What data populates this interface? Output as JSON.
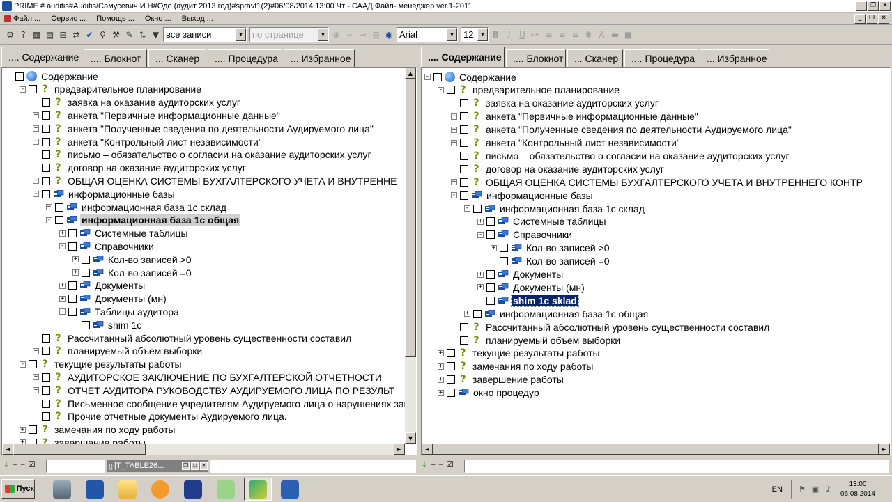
{
  "window": {
    "title": "PRIME # auditis#Auditis/Самусевич И.Н#Одо  (аудит 2013 год)#spravt1(2)#06/08/2014 13:00 Чт - САAД Файл- менеджер ver.1-2011",
    "controls": [
      "_",
      "❐",
      "✕"
    ]
  },
  "menu": {
    "items": [
      "Файл ...",
      "Сервис ...",
      "Помощь ...",
      "Окно ...",
      "Выход ..."
    ]
  },
  "toolbar": {
    "records_filter": "все записи",
    "per_page": "по странице",
    "font_name": "Arial",
    "font_size": "12",
    "format_buttons": [
      "B",
      "I",
      "U",
      "ABC"
    ]
  },
  "left_panel": {
    "tabs": [
      ".... Содержание",
      ".... Блокнот",
      "... Сканер",
      ".... Процедура",
      "... Избранное"
    ],
    "active_tab": 0,
    "tree": [
      {
        "label": "Содержание",
        "level": 0,
        "exp": "",
        "icon": "globe"
      },
      {
        "label": "предварительное планирование",
        "level": 1,
        "exp": "-",
        "icon": "q"
      },
      {
        "label": "заявка на оказание аудиторских услуг",
        "level": 2,
        "exp": "",
        "icon": "q"
      },
      {
        "label": "анкета \"Первичные информационные данные\"",
        "level": 2,
        "exp": "+",
        "icon": "q"
      },
      {
        "label": "анкета \"Полученные сведения по деятельности Аудируемого лица\"",
        "level": 2,
        "exp": "+",
        "icon": "q"
      },
      {
        "label": "анкета \"Контрольный лист независимости\"",
        "level": 2,
        "exp": "+",
        "icon": "q"
      },
      {
        "label": "письмо – обязательство о согласии на оказание аудиторских услуг",
        "level": 2,
        "exp": "",
        "icon": "q"
      },
      {
        "label": "договор на оказание аудиторских услуг",
        "level": 2,
        "exp": "",
        "icon": "q"
      },
      {
        "label": "ОБЩАЯ ОЦЕНКА СИСТЕМЫ БУХГАЛТЕРСКОГО УЧЕТА И ВНУТРЕННЕ",
        "level": 2,
        "exp": "+",
        "icon": "q"
      },
      {
        "label": "информационные базы",
        "level": 2,
        "exp": "-",
        "icon": "db"
      },
      {
        "label": "информационная база  1с склад",
        "level": 3,
        "exp": "+",
        "icon": "db"
      },
      {
        "label": "информационная база 1с общая",
        "level": 3,
        "exp": "-",
        "icon": "db",
        "sel": "grey"
      },
      {
        "label": "Системные таблицы",
        "level": 4,
        "exp": "+",
        "icon": "db"
      },
      {
        "label": "Справочники",
        "level": 4,
        "exp": "-",
        "icon": "db"
      },
      {
        "label": "Кол-во записей >0",
        "level": 5,
        "exp": "+",
        "icon": "db"
      },
      {
        "label": "Кол-во записей =0",
        "level": 5,
        "exp": "+",
        "icon": "db"
      },
      {
        "label": "Документы",
        "level": 4,
        "exp": "+",
        "icon": "db"
      },
      {
        "label": "Документы (мн)",
        "level": 4,
        "exp": "+",
        "icon": "db"
      },
      {
        "label": "Таблицы аудитора",
        "level": 4,
        "exp": "-",
        "icon": "db"
      },
      {
        "label": "shim 1c",
        "level": 5,
        "exp": "",
        "icon": "db"
      },
      {
        "label": "Рассчитанный абсолютный уровень существенности составил",
        "level": 2,
        "exp": "",
        "icon": "q"
      },
      {
        "label": "планируемый объем выборки",
        "level": 2,
        "exp": "+",
        "icon": "q"
      },
      {
        "label": "текущие результаты работы",
        "level": 1,
        "exp": "-",
        "icon": "q"
      },
      {
        "label": "АУДИТОРСКОЕ ЗАКЛЮЧЕНИЕ ПО БУХГАЛТЕРСКОЙ ОТЧЕТНОСТИ",
        "level": 2,
        "exp": "+",
        "icon": "q"
      },
      {
        "label": "ОТЧЕТ АУДИТОРА РУКОВОДСТВУ АУДИРУЕМОГО ЛИЦА ПО РЕЗУЛЬТ",
        "level": 2,
        "exp": "+",
        "icon": "q"
      },
      {
        "label": "Письменное сообщение учредителям Аудируемого лица о нарушениях зак",
        "level": 2,
        "exp": "",
        "icon": "q"
      },
      {
        "label": "Прочие отчетные документы Аудируемого лица.",
        "level": 2,
        "exp": "",
        "icon": "q"
      },
      {
        "label": "замечания по ходу работы",
        "level": 1,
        "exp": "+",
        "icon": "q"
      },
      {
        "label": "завершение работы",
        "level": 1,
        "exp": "+",
        "icon": "q"
      }
    ]
  },
  "right_panel": {
    "tabs": [
      ".... Содержание",
      ".... Блокнот",
      "... Сканер",
      ".... Процедура",
      "... Избранное"
    ],
    "active_tab": 0,
    "tree": [
      {
        "label": "Содержание",
        "level": 0,
        "exp": "-",
        "icon": "globe"
      },
      {
        "label": "предварительное планирование",
        "level": 1,
        "exp": "-",
        "icon": "q"
      },
      {
        "label": "заявка на оказание аудиторских услуг",
        "level": 2,
        "exp": "",
        "icon": "q"
      },
      {
        "label": "анкета \"Первичные информационные данные\"",
        "level": 2,
        "exp": "+",
        "icon": "q"
      },
      {
        "label": "анкета \"Полученные сведения по деятельности Аудируемого лица\"",
        "level": 2,
        "exp": "+",
        "icon": "q"
      },
      {
        "label": "анкета \"Контрольный лист независимости\"",
        "level": 2,
        "exp": "+",
        "icon": "q"
      },
      {
        "label": "письмо – обязательство о согласии на оказание аудиторских услуг",
        "level": 2,
        "exp": "",
        "icon": "q"
      },
      {
        "label": "договор на оказание аудиторских услуг",
        "level": 2,
        "exp": "",
        "icon": "q"
      },
      {
        "label": "ОБЩАЯ ОЦЕНКА СИСТЕМЫ БУХГАЛТЕРСКОГО УЧЕТА И ВНУТРЕННЕГО КОНТР",
        "level": 2,
        "exp": "+",
        "icon": "q"
      },
      {
        "label": "информационные базы",
        "level": 2,
        "exp": "-",
        "icon": "db"
      },
      {
        "label": "информационная база  1с склад",
        "level": 3,
        "exp": "-",
        "icon": "db"
      },
      {
        "label": "Системные таблицы",
        "level": 4,
        "exp": "+",
        "icon": "db"
      },
      {
        "label": "Справочники",
        "level": 4,
        "exp": "-",
        "icon": "db"
      },
      {
        "label": "Кол-во записей >0",
        "level": 5,
        "exp": "+",
        "icon": "db"
      },
      {
        "label": "Кол-во записей =0",
        "level": 5,
        "exp": "",
        "icon": "db"
      },
      {
        "label": "Документы",
        "level": 4,
        "exp": "+",
        "icon": "db"
      },
      {
        "label": "Документы (мн)",
        "level": 4,
        "exp": "+",
        "icon": "db"
      },
      {
        "label": "shim 1c sklad",
        "level": 4,
        "exp": "",
        "icon": "db",
        "sel": "blue"
      },
      {
        "label": "информационная база 1с общая",
        "level": 3,
        "exp": "+",
        "icon": "db"
      },
      {
        "label": "Рассчитанный абсолютный уровень существенности составил",
        "level": 2,
        "exp": "",
        "icon": "q"
      },
      {
        "label": "планируемый объем выборки",
        "level": 2,
        "exp": "",
        "icon": "q"
      },
      {
        "label": "текущие результаты работы",
        "level": 1,
        "exp": "+",
        "icon": "q"
      },
      {
        "label": "замечания по ходу работы",
        "level": 1,
        "exp": "+",
        "icon": "q"
      },
      {
        "label": "завершение работы",
        "level": 1,
        "exp": "+",
        "icon": "q"
      },
      {
        "label": "окно процедур",
        "level": 1,
        "exp": "+",
        "icon": "db"
      }
    ]
  },
  "bottom": {
    "left_controls": [
      "+",
      "−",
      "☑"
    ],
    "right_controls": [
      "+",
      "−",
      "☑"
    ],
    "minimized_window": "[T_TABLE26..."
  },
  "taskbar": {
    "start_label": "Пуск",
    "apps": [
      "server-manager",
      "powershell",
      "explorer",
      "fox-app",
      "save-app",
      "notepad-app",
      "db-app",
      "word"
    ],
    "language": "EN",
    "time": "13:00",
    "date": "06.08.2014"
  }
}
